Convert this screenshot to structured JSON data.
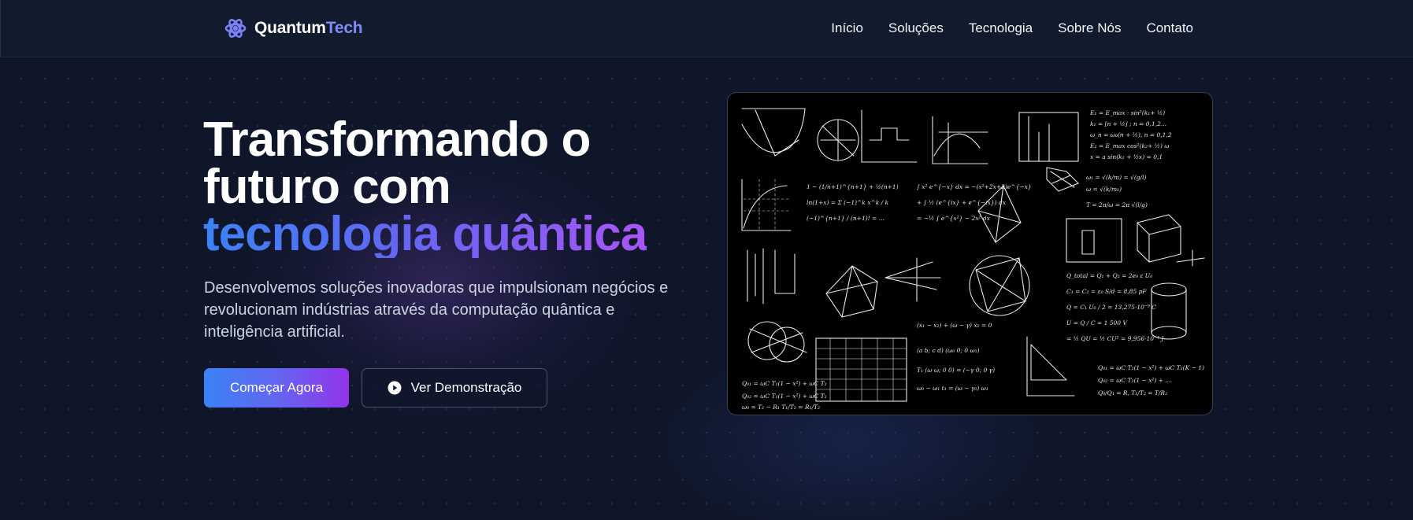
{
  "header": {
    "logo": {
      "part1": "Quantum",
      "part2": "Tech",
      "icon": "atom-icon",
      "accent": "#818cf8"
    },
    "nav": [
      {
        "label": "Início"
      },
      {
        "label": "Soluções"
      },
      {
        "label": "Tecnologia"
      },
      {
        "label": "Sobre Nós"
      },
      {
        "label": "Contato"
      }
    ]
  },
  "hero": {
    "title_line1": "Transformando o",
    "title_line2": "futuro com",
    "title_highlight": "tecnologia quântica",
    "description": "Desenvolvemos soluções inovadoras que impulsionam negócios e revolucionam indústrias através da computação quântica e inteligência artificial.",
    "primary_button": "Começar Agora",
    "secondary_button": "Ver Demonstração",
    "secondary_icon": "play-circle-icon",
    "image_subject": "chalkboard-formulas-image"
  },
  "colors": {
    "background": "#0f1629",
    "header": "#121a2d",
    "gradient_start": "#3b82f6",
    "gradient_mid": "#6366f1",
    "gradient_end": "#a855f7"
  }
}
